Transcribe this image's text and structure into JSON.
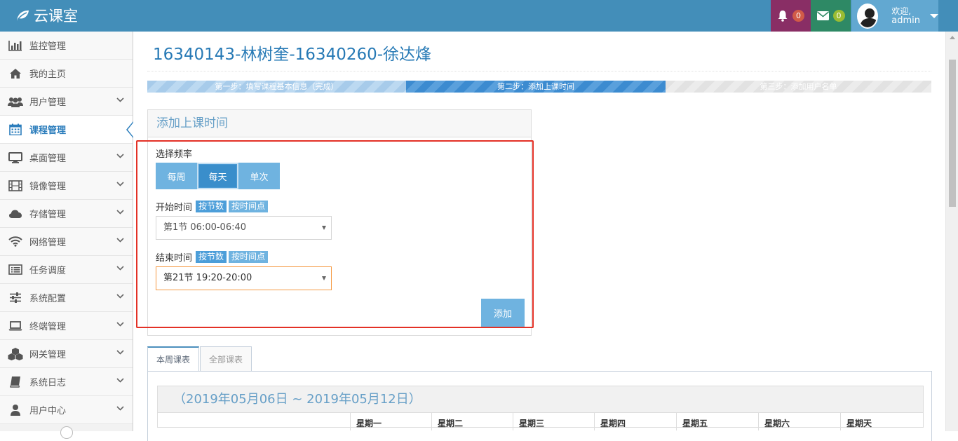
{
  "header": {
    "brand": "云课室",
    "notifications_count": "0",
    "messages_count": "0",
    "welcome": "欢迎,",
    "username": "admin"
  },
  "sidebar": {
    "items": [
      {
        "label": "监控管理",
        "icon": "bar-chart-icon"
      },
      {
        "label": "我的主页",
        "icon": "home-icon"
      },
      {
        "label": "用户管理",
        "icon": "users-icon"
      },
      {
        "label": "课程管理",
        "icon": "calendar-icon"
      },
      {
        "label": "桌面管理",
        "icon": "desktop-icon"
      },
      {
        "label": "镜像管理",
        "icon": "film-icon"
      },
      {
        "label": "存储管理",
        "icon": "cloud-icon"
      },
      {
        "label": "网络管理",
        "icon": "wifi-icon"
      },
      {
        "label": "任务调度",
        "icon": "list-icon"
      },
      {
        "label": "系统配置",
        "icon": "sliders-icon"
      },
      {
        "label": "终端管理",
        "icon": "laptop-icon"
      },
      {
        "label": "网关管理",
        "icon": "cubes-icon"
      },
      {
        "label": "系统日志",
        "icon": "book-icon"
      },
      {
        "label": "用户中心",
        "icon": "user-icon"
      }
    ],
    "active": "课程管理"
  },
  "page": {
    "title": "16340143-林树奎-16340260-徐达烽"
  },
  "steps": [
    {
      "label": "第一步：填写课程基本信息（完成）",
      "state": "done"
    },
    {
      "label": "第二步：添加上课时间",
      "state": "current"
    },
    {
      "label": "第三步：添加用户名单",
      "state": "todo"
    }
  ],
  "form": {
    "heading": "添加上课时间",
    "freq_label": "选择频率",
    "freq_options": [
      "每周",
      "每天",
      "单次"
    ],
    "freq_selected": "每天",
    "start_label": "开始时间",
    "end_label": "结束时间",
    "mode_by_period": "按节数",
    "mode_by_time": "按时间点",
    "start_value": "第1节 06:00-06:40",
    "end_value": "第21节 19:20-20:00",
    "add_button": "添加"
  },
  "tabs": [
    {
      "label": "本周课表",
      "active": true
    },
    {
      "label": "全部课表",
      "active": false
    }
  ],
  "schedule": {
    "range": "（2019年05月06日 ~ 2019年05月12日）",
    "days": [
      "星期一",
      "星期二",
      "星期三",
      "星期四",
      "星期五",
      "星期六",
      "星期天"
    ]
  },
  "colors": {
    "topbar": "#438eb9",
    "accent": "#2679b5",
    "button": "#6fb3e0",
    "highlight": "#e33126"
  }
}
